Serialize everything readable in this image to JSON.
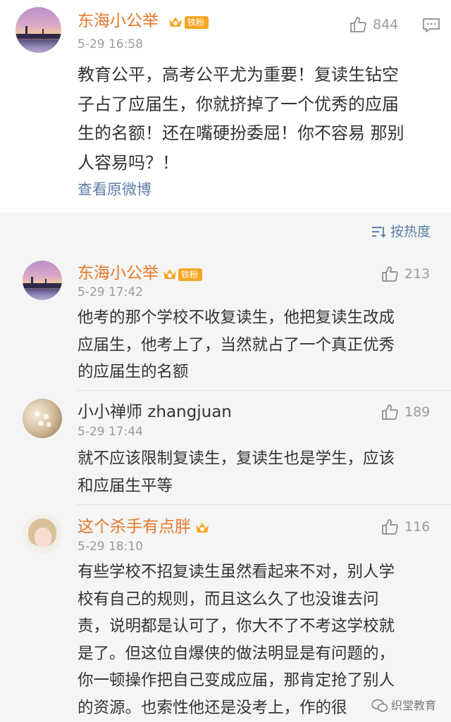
{
  "post": {
    "author": "东海小公举",
    "fan_badge": "铁粉",
    "time": "5-29 16:58",
    "likes": "844",
    "lines": [
      "教育公平，高考公平尤为重要！复读生钻空",
      "子占了应届生，你就挤掉了一个优秀的应届",
      "生的名额！还在嘴硬扮委屈！你不容易 那别",
      "人容易吗？！"
    ],
    "view_original": "查看原微博"
  },
  "sort_label": "按热度",
  "comments": [
    {
      "author": "东海小公举",
      "fan_badge": "铁粉",
      "time": "5-29 17:42",
      "likes": "213",
      "lines": [
        "他考的那个学校不收复读生，他把复读生改成",
        "应届生，他考上了，当然就占了一个真正优秀",
        "的应届生的名额"
      ]
    },
    {
      "author": "小小禅师 zhangjuan",
      "time": "5-29 17:44",
      "likes": "189",
      "lines": [
        "就不应该限制复读生，复读生也是学生，应该",
        "和应届生平等"
      ]
    },
    {
      "author": "这个杀手有点胖",
      "time": "5-29 18:10",
      "likes": "116",
      "lines": [
        "有些学校不招复读生虽然看起来不对，别人学",
        "校有自己的规则，而且这么久了也没谁去问",
        "责，说明都是认可了，你大不了不考这学校就",
        "是了。但这位自爆侠的做法明显是有问题的，",
        "你一顿操作把自己变成应届，那肯定抢了别人",
        "的资源。也索性他还是没考上，作的很"
      ]
    }
  ],
  "watermark": "织堂教育",
  "colors": {
    "username": "#e3792a",
    "link": "#5b7ea8",
    "muted": "#9b9b9b",
    "reply_bg": "#f5f5f5"
  },
  "icons": [
    "thumbs-up-icon",
    "comment-icon",
    "sort-icon",
    "crown-icon",
    "wechat-icon"
  ]
}
